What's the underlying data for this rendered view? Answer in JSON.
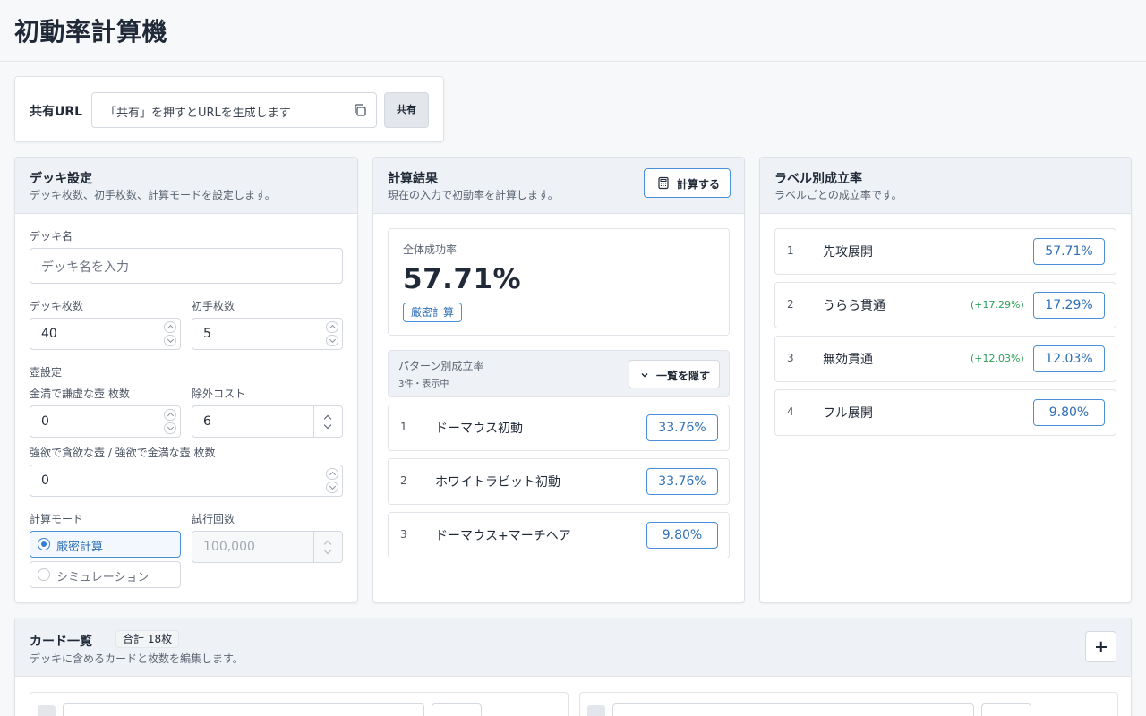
{
  "app": {
    "title": "初動率計算機"
  },
  "share": {
    "label": "共有URL",
    "placeholder": "「共有」を押すとURLを生成します",
    "button_label": "共有"
  },
  "deck_settings": {
    "title": "デッキ設定",
    "description": "デッキ枚数、初手枚数、計算モードを設定します。",
    "deck_name_label": "デッキ名",
    "deck_name_placeholder": "デッキ名を入力",
    "deck_size_label": "デッキ枚数",
    "deck_size_value": "40",
    "hand_size_label": "初手枚数",
    "hand_size_value": "5",
    "pot_section_label": "壺設定",
    "pot_modest_label": "金満で謙虚な壺 枚数",
    "pot_modest_value": "0",
    "banish_cost_label": "除外コスト",
    "banish_cost_value": "6",
    "pot_greed_label": "強欲で貪欲な壺 / 強欲で金満な壺 枚数",
    "pot_greed_value": "0",
    "mode_label": "計算モード",
    "mode_options": [
      "厳密計算",
      "シミュレーション"
    ],
    "mode_selected": "厳密計算",
    "trials_label": "試行回数",
    "trials_placeholder": "100,000"
  },
  "results": {
    "title": "計算結果",
    "description": "現在の入力で初動率を計算します。",
    "calc_button_label": "計算する",
    "total_label": "全体成功率",
    "total_value": "57.71%",
    "mode_badge": "厳密計算",
    "pattern_title": "パターン別成立率",
    "pattern_sub": "3件・表示中",
    "hide_button_label": "一覧を隠す",
    "patterns": [
      {
        "no": "1",
        "name": "ドーマウス初動",
        "rate": "33.76%"
      },
      {
        "no": "2",
        "name": "ホワイトラビット初動",
        "rate": "33.76%"
      },
      {
        "no": "3",
        "name": "ドーマウス+マーチヘア",
        "rate": "9.80%"
      }
    ]
  },
  "labels": {
    "title": "ラベル別成立率",
    "description": "ラベルごとの成立率です。",
    "items": [
      {
        "no": "1",
        "name": "先攻展開",
        "delta": "",
        "rate": "57.71%"
      },
      {
        "no": "2",
        "name": "うらら貫通",
        "delta": "(+17.29%)",
        "rate": "17.29%"
      },
      {
        "no": "3",
        "name": "無効貫通",
        "delta": "(+12.03%)",
        "rate": "12.03%"
      },
      {
        "no": "4",
        "name": "フル展開",
        "delta": "",
        "rate": "9.80%"
      }
    ]
  },
  "cards": {
    "title": "カード一覧",
    "count_badge": "合計 18枚",
    "description": "デッキに含めるカードと枚数を編集します。"
  },
  "colors": {
    "accent": "#2f7fd6",
    "positive": "#2f9e5a",
    "danger": "#d64545"
  }
}
